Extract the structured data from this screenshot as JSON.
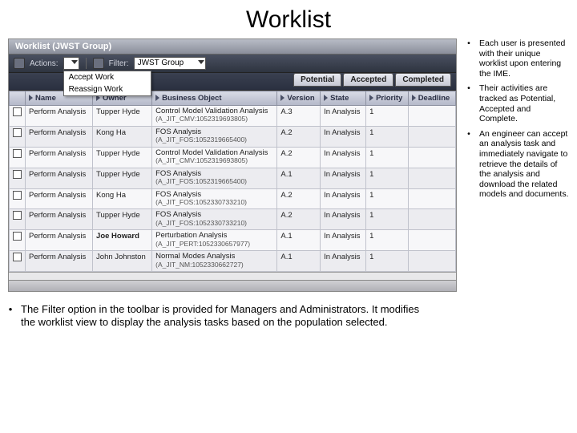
{
  "title": "Worklist",
  "panel": {
    "header": "Worklist (JWST Group)",
    "toolbar": {
      "actions_label": "Actions:",
      "actions_menu": [
        "Accept Work",
        "Reassign Work"
      ],
      "filter_label": "Filter:",
      "filter_value": "JWST Group"
    },
    "status_tabs": [
      "Potential",
      "Accepted",
      "Completed"
    ],
    "columns": [
      "",
      "Name",
      "Owner",
      "Business Object",
      "Version",
      "State",
      "Priority",
      "Deadline"
    ],
    "rows": [
      {
        "name": "Perform Analysis",
        "owner": "Tupper Hyde",
        "bo": "Control Model Validation Analysis",
        "bosub": "(A_JIT_CMV:1052319693805)",
        "ver": "A.3",
        "state": "In Analysis",
        "prio": "1",
        "dl": "",
        "bold": false
      },
      {
        "name": "Perform Analysis",
        "owner": "Kong Ha",
        "bo": "FOS Analysis",
        "bosub": "(A_JIT_FOS:1052319665400)",
        "ver": "A.2",
        "state": "In Analysis",
        "prio": "1",
        "dl": "",
        "bold": false
      },
      {
        "name": "Perform Analysis",
        "owner": "Tupper Hyde",
        "bo": "Control Model Validation Analysis",
        "bosub": "(A_JIT_CMV:1052319693805)",
        "ver": "A.2",
        "state": "In Analysis",
        "prio": "1",
        "dl": "",
        "bold": false
      },
      {
        "name": "Perform Analysis",
        "owner": "Tupper Hyde",
        "bo": "FOS Analysis",
        "bosub": "(A_JIT_FOS:1052319665400)",
        "ver": "A.1",
        "state": "In Analysis",
        "prio": "1",
        "dl": "",
        "bold": false
      },
      {
        "name": "Perform Analysis",
        "owner": "Kong Ha",
        "bo": "FOS Analysis",
        "bosub": "(A_JIT_FOS:1052330733210)",
        "ver": "A.2",
        "state": "In Analysis",
        "prio": "1",
        "dl": "",
        "bold": false
      },
      {
        "name": "Perform Analysis",
        "owner": "Tupper Hyde",
        "bo": "FOS Analysis",
        "bosub": "(A_JIT_FOS:1052330733210)",
        "ver": "A.2",
        "state": "In Analysis",
        "prio": "1",
        "dl": "",
        "bold": false
      },
      {
        "name": "Perform Analysis",
        "owner": "Joe Howard",
        "bo": "Perturbation Analysis",
        "bosub": "(A_JIT_PERT:1052330657977)",
        "ver": "A.1",
        "state": "In Analysis",
        "prio": "1",
        "dl": "",
        "bold": true
      },
      {
        "name": "Perform Analysis",
        "owner": "John Johnston",
        "bo": "Normal Modes Analysis",
        "bosub": "(A_JIT_NM:1052330662727)",
        "ver": "A.1",
        "state": "In Analysis",
        "prio": "1",
        "dl": "",
        "bold": false
      }
    ]
  },
  "right_bullets": [
    "Each user is presented with their unique worklist upon entering the IME.",
    "Their activities are tracked as Potential, Accepted and Complete.",
    "An engineer can accept an analysis task and immediately navigate to retrieve the details of the analysis and download the related models and documents."
  ],
  "bottom_bullet": "The Filter option in the toolbar is provided for Managers and Administrators.  It modifies the worklist view to display the analysis tasks based on the population selected."
}
